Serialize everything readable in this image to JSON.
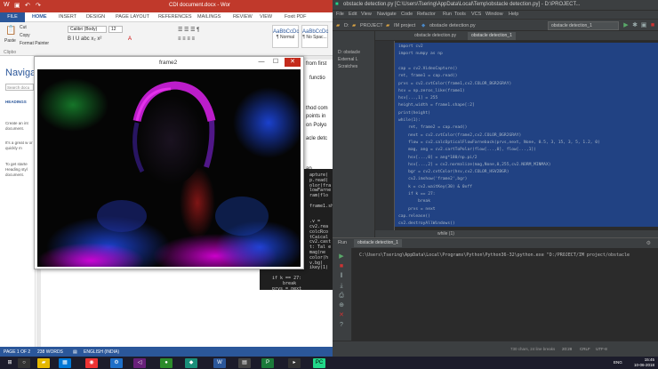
{
  "word": {
    "title": "CDI document.docx - Wor",
    "file_tab": "FILE",
    "tabs": [
      "HOME",
      "INSERT",
      "DESIGN",
      "PAGE LAYOUT",
      "REFERENCES",
      "MAILINGS",
      "REVIEW",
      "VIEW",
      "Foxit PDF"
    ],
    "ribbon": {
      "cut": "Cut",
      "copy": "Copy",
      "paste": "Paste",
      "format_painter": "Format Painter",
      "clipboard_label": "Clipbo",
      "font_name": "Calibri (Body)",
      "font_size": "12",
      "style1_sample": "AaBbCcDc",
      "style1_name": "¶ Normal",
      "style2_sample": "AaBbCcDc",
      "style2_name": "¶ No Spac..."
    },
    "nav": {
      "title": "Naviga",
      "search_placeholder": "Search docu",
      "headings": "HEADINGS",
      "para1": "Create an int document.",
      "para2": "It's a great w or quickly m",
      "para3": "To get starte Heading styl document."
    },
    "doc_lines": [
      "from first",
      "functio",
      "thod com",
      "points in",
      "on Polyo",
      "acle detc",
      "ap"
    ],
    "status": {
      "page": "PAGE 1 OF 2",
      "words": "238 WORDS",
      "language": "ENGLISH (INDIA)"
    }
  },
  "frame2": {
    "title": "frame2",
    "minimize": "—",
    "maximize": "☐",
    "close": "✕"
  },
  "terminal": {
    "lines": [
      "apture(",
      "p.read(",
      "olor(fra",
      "lowFarne",
      "ram(flo",
      "",
      "frame1.sh",
      "",
      "",
      ".v = ",
      "cv2.rea",
      "colcRco",
      "tCaical",
      "cv2.cast",
      "t: Tal e",
      "mag(ne",
      "color(h",
      "v.bg)",
      "ikey(1)",
      "",
      "if k == 27:",
      "    break",
      "prvs = next"
    ]
  },
  "pycharm": {
    "title": "obstacle detection.py [C:\\Users\\Tsering\\AppData\\Local\\Temp\\obstacle detection.py] - D:\\PROJECT...",
    "menu": [
      "File",
      "Edit",
      "View",
      "Navigate",
      "Code",
      "Refactor",
      "Run",
      "Tools",
      "VCS",
      "Window",
      "Help"
    ],
    "breadcrumb": [
      "D:",
      "PROJECT",
      "IM project"
    ],
    "crumb_file": "obstacle detection.py",
    "crumb_file2": "obstacle detection.py",
    "run_config": "obstacle detection_1",
    "project_tree": [
      "D: obstacle",
      "External L",
      "Scratches"
    ],
    "tabs": [
      "obstacle detection.py",
      "obstacle detection_1"
    ],
    "code": [
      "import cv2",
      "import numpy as np",
      "",
      "cap = cv2.VideoCapture()",
      "ret, frame1 = cap.read()",
      "prvs = cv2.cvtColor(frame1,cv2.COLOR_BGR2GRAY)",
      "hsv = np.zeros_like(frame1)",
      "hsv[...,1] = 255",
      "height,width = frame1.shape[:2]",
      "print(height)",
      "while(1):",
      "    ret, frame2 = cap.read()",
      "    next = cv2.cvtColor(frame2,cv2.COLOR_BGR2GRAY)",
      "    flow = cv2.calcOpticalFlowFarneback(prvs,next, None, 0.5, 3, 15, 3, 5, 1.2, 0)",
      "    mag, ang = cv2.cartToPolar(flow[...,0], flow[...,1])",
      "    hsv[...,0] = ang*180/np.pi/2",
      "    hsv[...,2] = cv2.normalize(mag,None,0,255,cv2.NORM_MINMAX)",
      "    bgr = cv2.cvtColor(hsv,cv2.COLOR_HSV2BGR)",
      "    cv2.imshow('frame2',bgr)",
      "    k = cv2.waitKey(30) & 0xff",
      "    if k == 27:",
      "        break",
      "    prvs = next",
      "cap.release()",
      "cv2.destroyAllWindows()"
    ],
    "editor_crumb": "while (1)",
    "run": {
      "label": "Run",
      "tab": "obstacle detection_1",
      "output": "C:\\Users\\Tsering\\AppData\\Local\\Programs\\Python\\Python36-32\\python.exe \"D:/PROJECT/IM project/obstacle"
    },
    "status": {
      "selection": "730 chars, 24 line breaks",
      "position": "20:28",
      "line_sep": "CRLF",
      "encoding": "UTF-8"
    }
  },
  "taskbar": {
    "lang": "ENG",
    "time": "15:45",
    "date": "10-06-2018"
  },
  "colors": {
    "word_red": "#c0392b",
    "word_blue": "#2b579a",
    "pycharm_bg": "#2b2b2b",
    "selection": "#214283"
  }
}
